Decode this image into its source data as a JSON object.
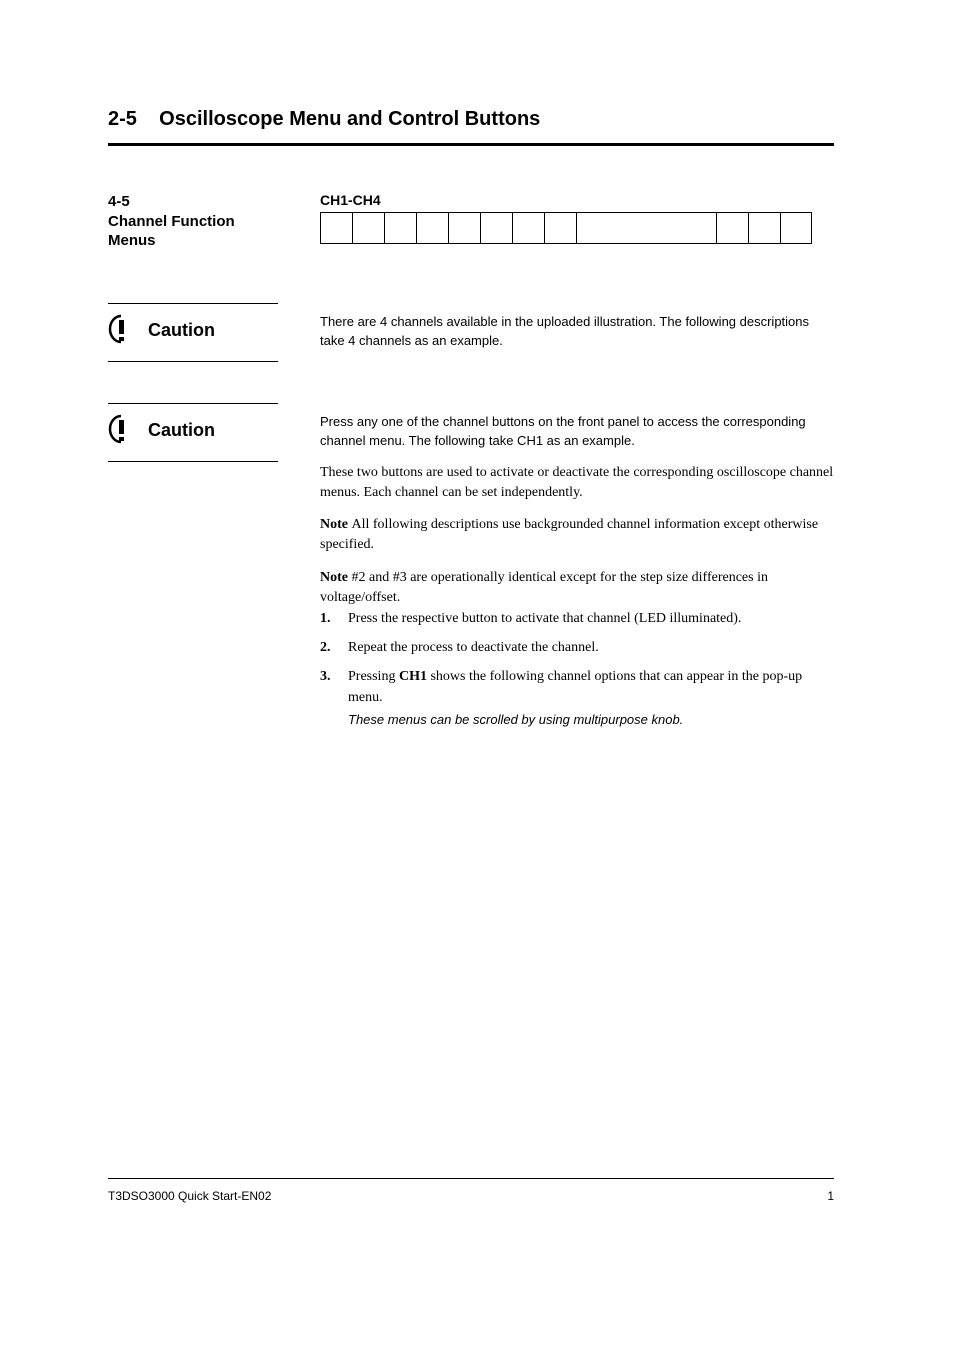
{
  "section": {
    "number": "2-5",
    "title": "Oscilloscope Menu and Control Buttons"
  },
  "controls": {
    "sidebar_label_line1": "4-5",
    "sidebar_label_line2": "Channel Function",
    "sidebar_label_line3": "Menus",
    "heading": "CH1-CH4"
  },
  "box_count": 12,
  "wide_box_index": 8,
  "caution1": {
    "label": "Caution",
    "body": "There are 4 channels available in the uploaded illustration. The following descriptions take 4 channels as an example."
  },
  "caution2": {
    "label": "Caution",
    "body_prefix": "Press any one of the channel buttons on the front panel to access the corresponding channel menu. The following take CH1 as an example.",
    "body_main": "These two buttons are used to activate or deactivate the corresponding oscilloscope channel menus. Each channel can be set independently."
  },
  "notes": {
    "note1": "All following descriptions use backgrounded channel information except otherwise specified.",
    "note2": "#2 and #3 are operationally identical except for the step size differences in voltage/offset."
  },
  "steps": [
    {
      "num": "1.",
      "text": "Press the respective button to activate that channel (LED illuminated)."
    },
    {
      "num": "2.",
      "text": "Repeat the process to deactivate the channel."
    },
    {
      "num": "3.",
      "text_prefix": "Pressing ",
      "bold": "CH1",
      "text_suffix": " shows the following channel options that can appear in the pop-up menu.",
      "sub": "These menus can be scrolled by using multipurpose knob."
    }
  ],
  "footer": {
    "left": "T3DSO3000 Quick Start-EN02",
    "right": "1"
  }
}
